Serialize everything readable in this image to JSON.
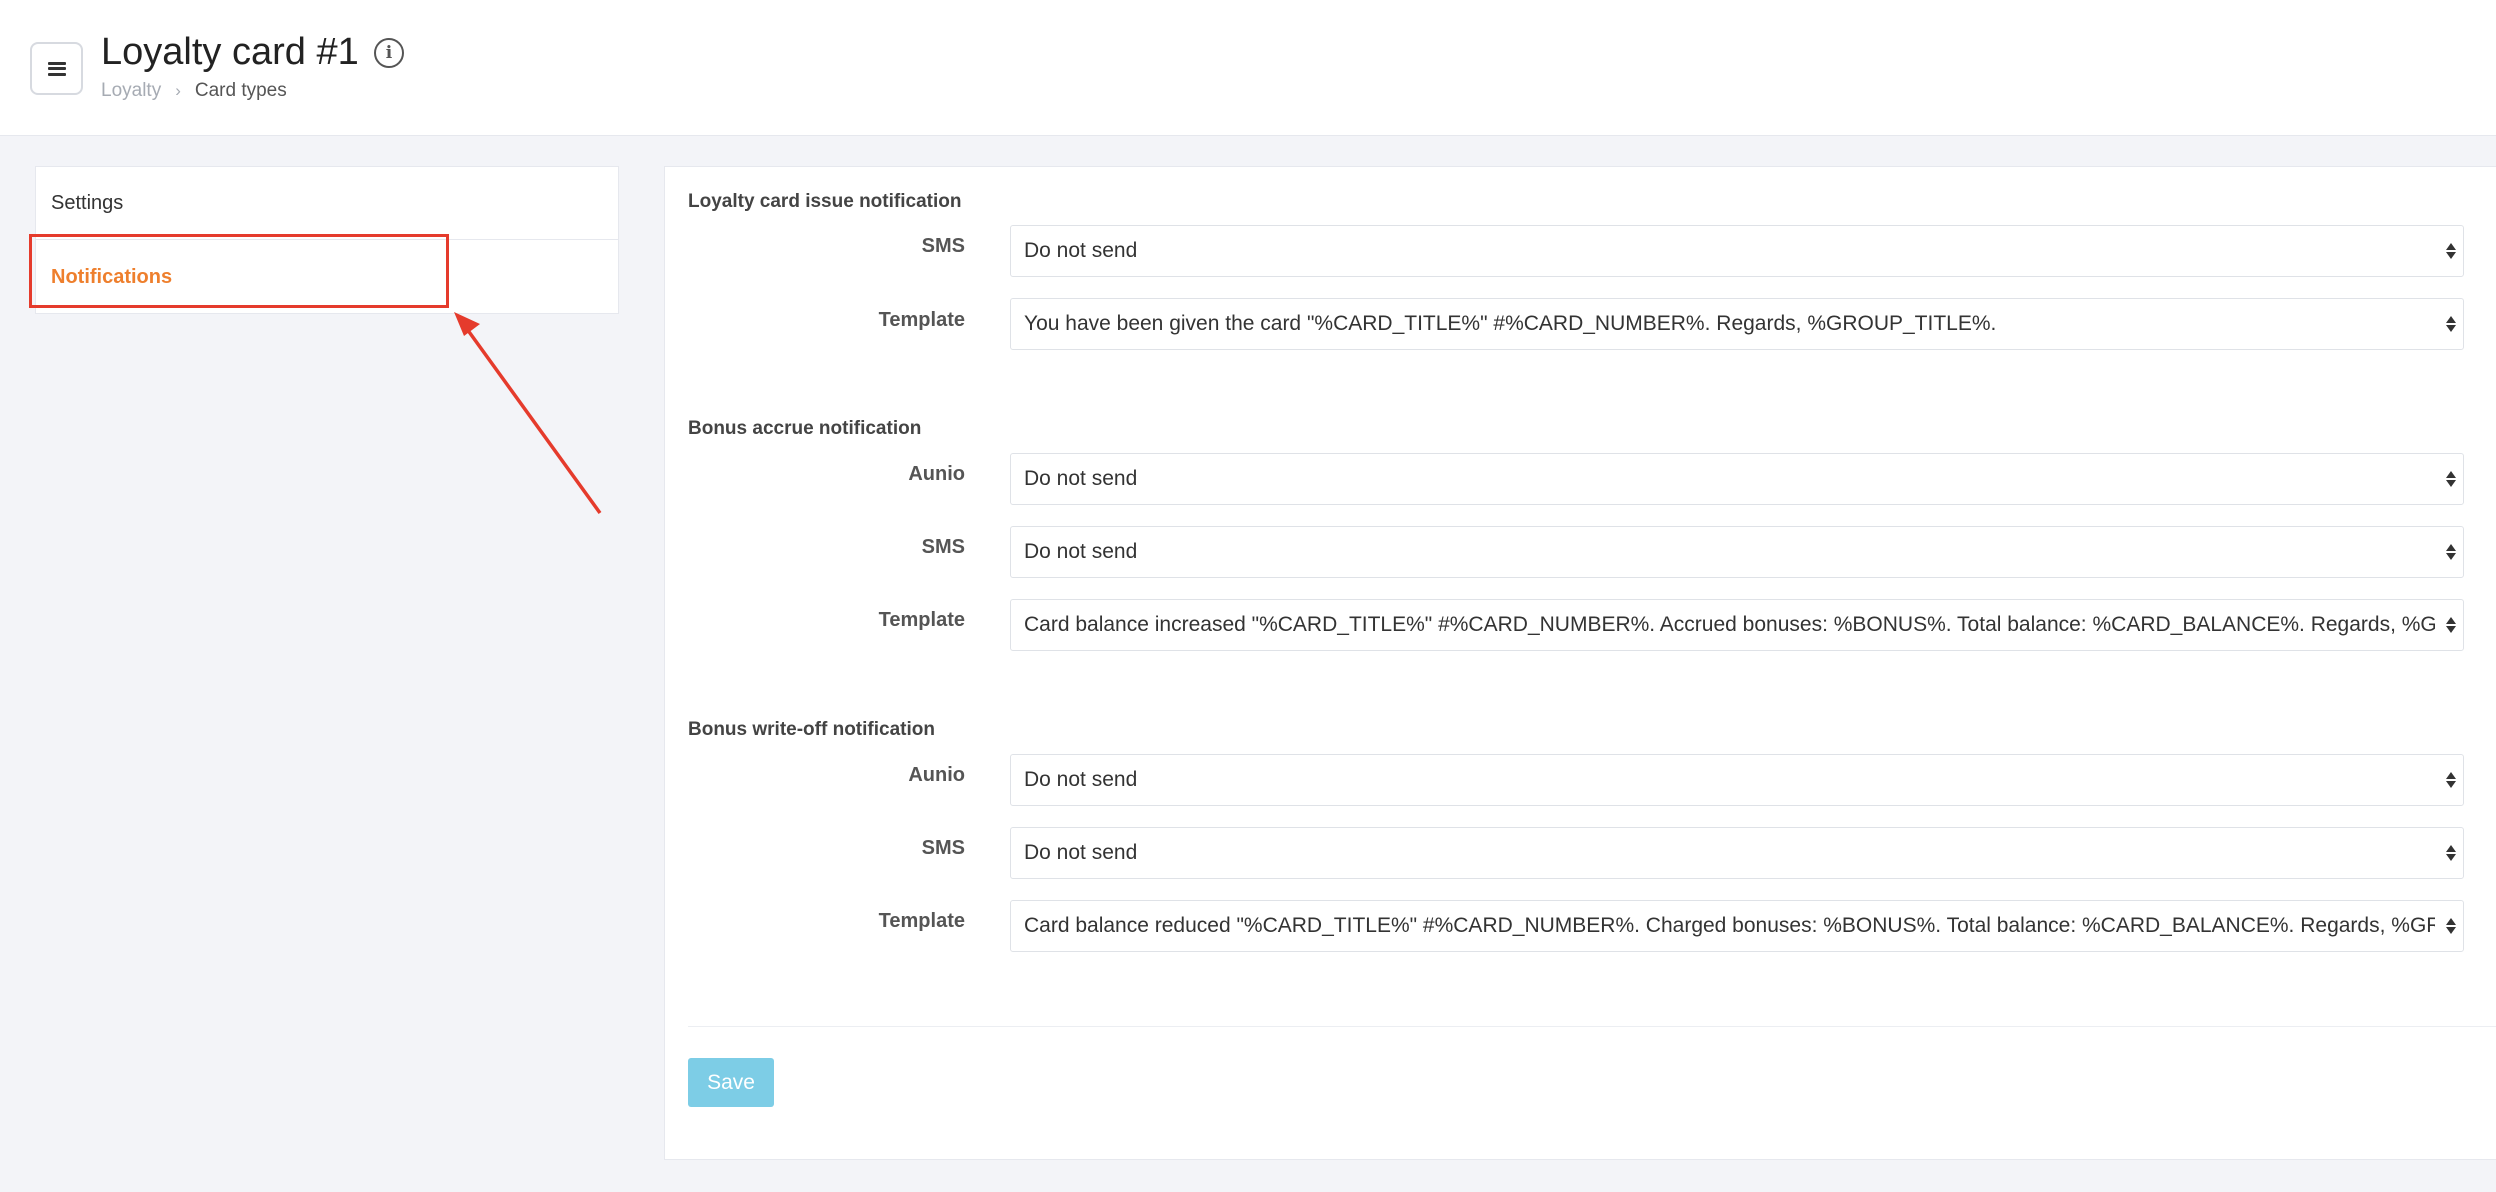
{
  "header": {
    "title": "Loyalty card #1",
    "breadcrumb": {
      "parent": "Loyalty",
      "current": "Card types"
    }
  },
  "sidebar": {
    "items": [
      {
        "label": "Settings",
        "active": false
      },
      {
        "label": "Notifications",
        "active": true
      }
    ]
  },
  "sections": {
    "issue": {
      "title": "Loyalty card issue notification",
      "sms_label": "SMS",
      "sms_value": "Do not send",
      "template_label": "Template",
      "template_value": "You have been given the card \"%CARD_TITLE%\" #%CARD_NUMBER%. Regards, %GROUP_TITLE%."
    },
    "accrue": {
      "title": "Bonus accrue notification",
      "aunio_label": "Aunio",
      "aunio_value": "Do not send",
      "sms_label": "SMS",
      "sms_value": "Do not send",
      "template_label": "Template",
      "template_value": "Card balance increased \"%CARD_TITLE%\" #%CARD_NUMBER%. Accrued bonuses: %BONUS%. Total balance: %CARD_BALANCE%. Regards, %GROUP_TITLE%."
    },
    "writeoff": {
      "title": "Bonus write-off notification",
      "aunio_label": "Aunio",
      "aunio_value": "Do not send",
      "sms_label": "SMS",
      "sms_value": "Do not send",
      "template_label": "Template",
      "template_value": "Card balance reduced \"%CARD_TITLE%\" #%CARD_NUMBER%. Charged bonuses: %BONUS%. Total balance: %CARD_BALANCE%. Regards, %GROUP_TITLE%."
    }
  },
  "actions": {
    "save_label": "Save"
  },
  "colors": {
    "accent": "#ee7f2d",
    "highlight": "#e53b2c",
    "save_button": "#7dcde6",
    "background": "#f3f4f8"
  }
}
